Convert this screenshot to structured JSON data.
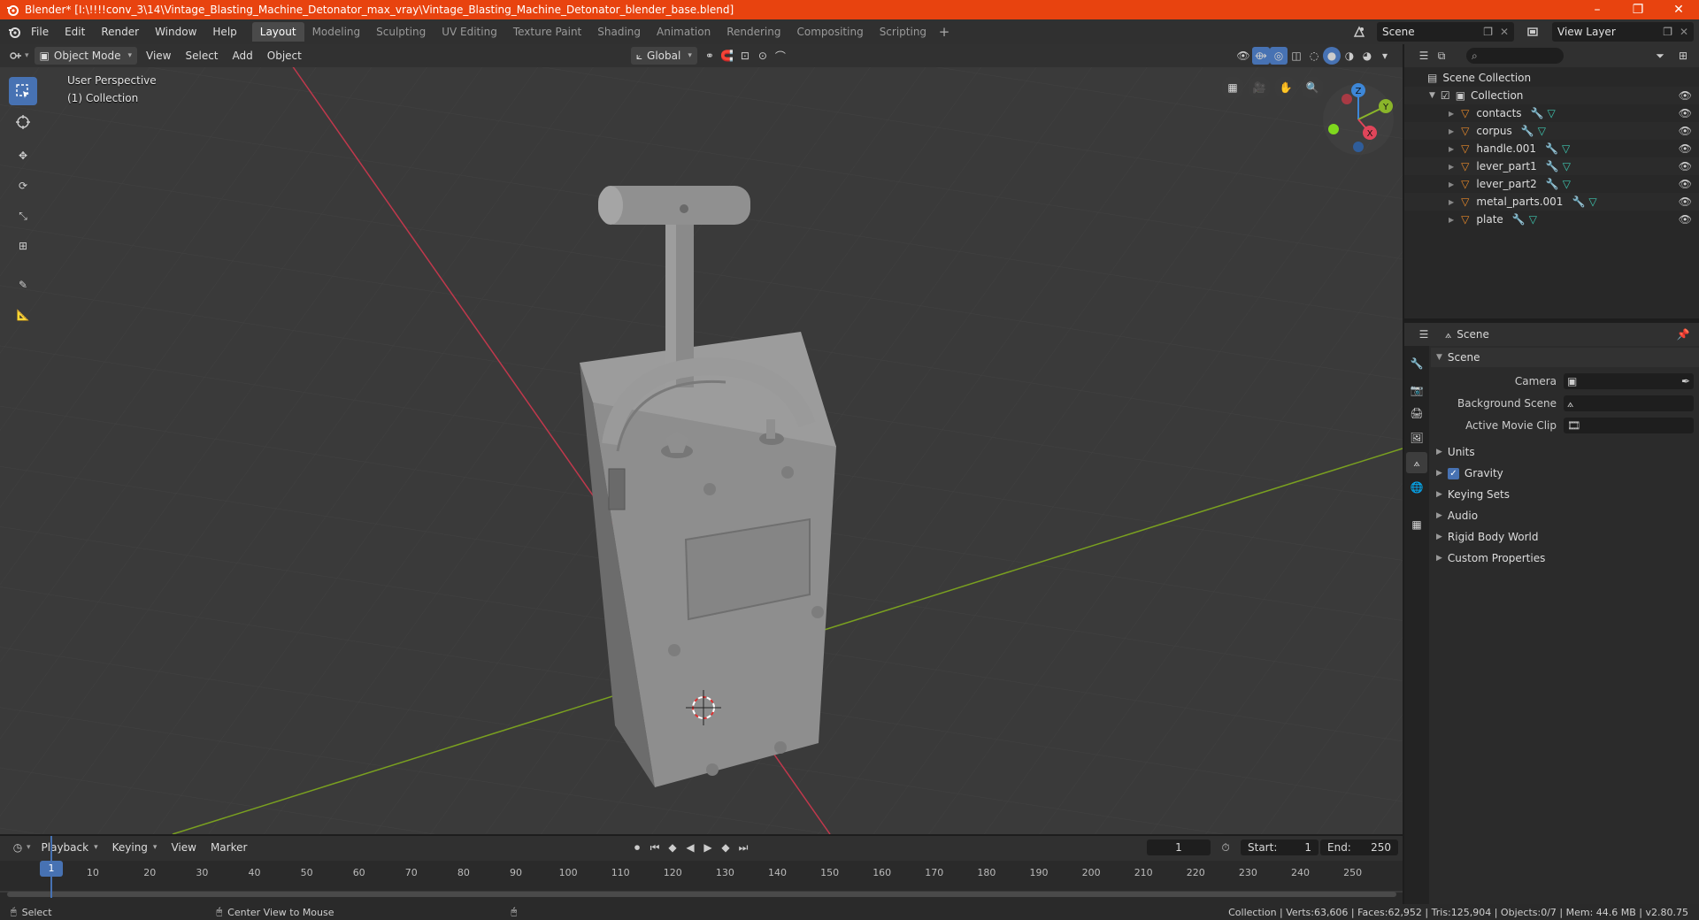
{
  "window": {
    "title": "Blender* [I:\\!!!!conv_3\\14\\Vintage_Blasting_Machine_Detonator_max_vray\\Vintage_Blasting_Machine_Detonator_blender_base.blend]",
    "controls": [
      "–",
      "❐",
      "✕"
    ]
  },
  "menu": [
    "File",
    "Edit",
    "Render",
    "Window",
    "Help"
  ],
  "workspaces": [
    "Layout",
    "Modeling",
    "Sculpting",
    "UV Editing",
    "Texture Paint",
    "Shading",
    "Animation",
    "Rendering",
    "Compositing",
    "Scripting"
  ],
  "active_workspace": "Layout",
  "scene_name": "Scene",
  "view_layer": "View Layer",
  "viewport": {
    "mode": "Object Mode",
    "menus": [
      "View",
      "Select",
      "Add",
      "Object"
    ],
    "orientation": "Global",
    "perspective_label": "User Perspective",
    "collection_label": "(1) Collection",
    "gizmo_axes": [
      "Z",
      "Y",
      "X"
    ]
  },
  "outliner": {
    "root": "Scene Collection",
    "collection": "Collection",
    "objects": [
      "contacts",
      "corpus",
      "handle.001",
      "lever_part1",
      "lever_part2",
      "metal_parts.001",
      "plate"
    ]
  },
  "properties": {
    "header": "Scene",
    "panel_title": "Scene",
    "camera_label": "Camera",
    "background_scene_label": "Background Scene",
    "active_movie_clip_label": "Active Movie Clip",
    "subpanels": [
      "Units",
      "Gravity",
      "Keying Sets",
      "Audio",
      "Rigid Body World",
      "Custom Properties"
    ]
  },
  "timeline": {
    "menus": [
      "Playback",
      "Keying",
      "View",
      "Marker"
    ],
    "current_frame": "1",
    "start_label": "Start:",
    "start": "1",
    "end_label": "End:",
    "end": "250",
    "ticks": [
      "1",
      "10",
      "20",
      "30",
      "40",
      "50",
      "60",
      "70",
      "80",
      "90",
      "100",
      "110",
      "120",
      "130",
      "140",
      "150",
      "160",
      "170",
      "180",
      "190",
      "200",
      "210",
      "220",
      "230",
      "240",
      "250"
    ]
  },
  "status": {
    "left_action": "Select",
    "middle_action": "Center View to Mouse",
    "stats": "Collection | Verts:63,606 | Faces:62,952 | Tris:125,904 | Objects:0/7 | Mem: 44.6 MB | v2.80.75"
  },
  "colors": {
    "title_bar": "#e8430f",
    "active_tool": "#4772b3",
    "axis_x": "#e0455a",
    "axis_y": "#8ab52a",
    "axis_z": "#3d87d8"
  }
}
